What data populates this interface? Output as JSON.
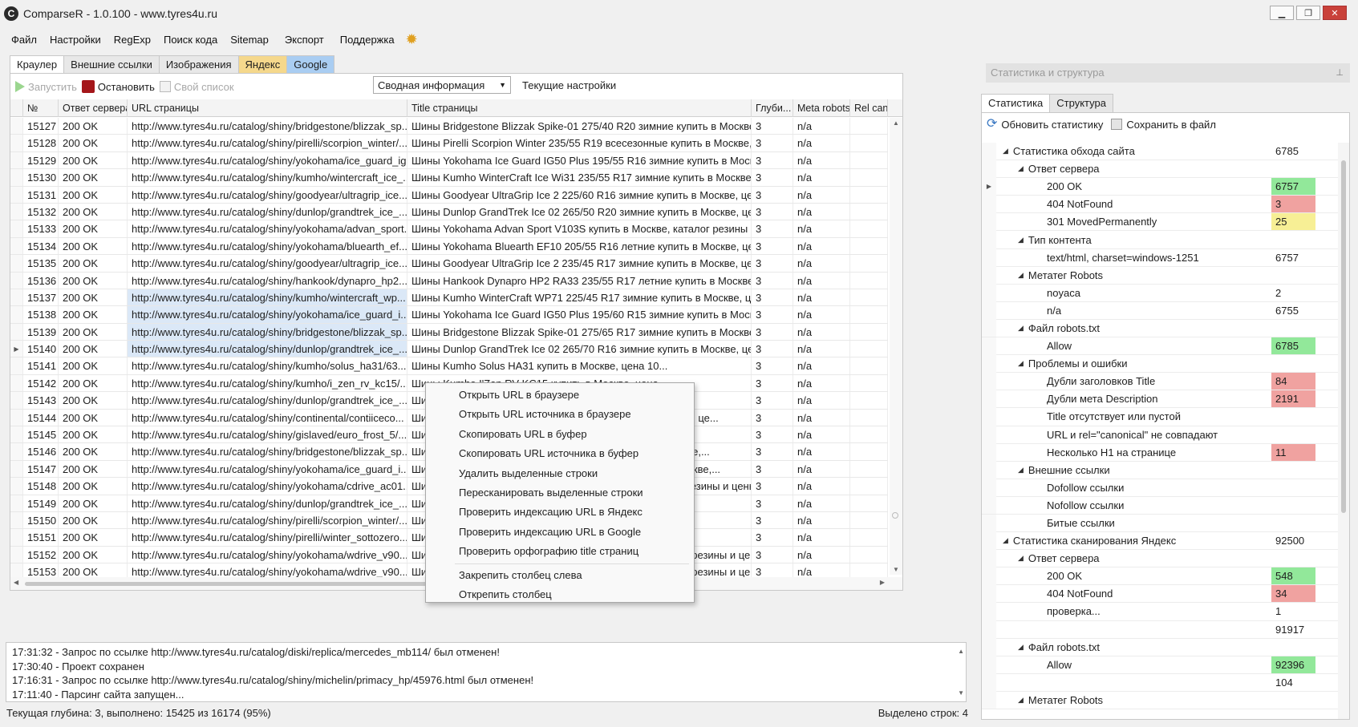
{
  "window": {
    "title": "ComparseR - 1.0.100 - www.tyres4u.ru",
    "logo_letter": "C",
    "minimize": "▁",
    "maximize": "❐",
    "close": "✕"
  },
  "menu": [
    "Файл",
    "Настройки",
    "RegExp",
    "Поиск кода",
    "Sitemap",
    "Экспорт",
    "Поддержка"
  ],
  "tabs": [
    "Краулер",
    "Внешние ссылки",
    "Изображения",
    "Яндекс",
    "Google"
  ],
  "toolbar": {
    "start": "Запустить",
    "stop": "Остановить",
    "own_list": "Свой список",
    "view_select": "Сводная информация",
    "current_settings": "Текущие настройки"
  },
  "grid": {
    "columns": [
      "№",
      "Ответ сервера",
      "URL страницы",
      "Title страницы",
      "Глуби...",
      "Meta robots",
      "Rel canc"
    ],
    "rows": [
      {
        "num": "15127",
        "resp": "200 OK",
        "url": "http://www.tyres4u.ru/catalog/shiny/bridgestone/blizzak_sp...",
        "title": "Шины Bridgestone Blizzak Spike-01 275/40 R20 зимние купить в Москве,...",
        "depth": "3",
        "meta": "n/a",
        "rel": ""
      },
      {
        "num": "15128",
        "resp": "200 OK",
        "url": "http://www.tyres4u.ru/catalog/shiny/pirelli/scorpion_winter/...",
        "title": "Шины Pirelli Scorpion Winter 235/55 R19 всесезонные купить в Москве,...",
        "depth": "3",
        "meta": "n/a",
        "rel": ""
      },
      {
        "num": "15129",
        "resp": "200 OK",
        "url": "http://www.tyres4u.ru/catalog/shiny/yokohama/ice_guard_ig...",
        "title": "Шины Yokohama Ice Guard IG50 Plus 195/55 R16 зимние купить в Москве,...",
        "depth": "3",
        "meta": "n/a",
        "rel": ""
      },
      {
        "num": "15130",
        "resp": "200 OK",
        "url": "http://www.tyres4u.ru/catalog/shiny/kumho/wintercraft_ice_...",
        "title": "Шины Kumho WinterCraft Ice Wi31 235/55 R17 зимние купить в Москве,...",
        "depth": "3",
        "meta": "n/a",
        "rel": ""
      },
      {
        "num": "15131",
        "resp": "200 OK",
        "url": "http://www.tyres4u.ru/catalog/shiny/goodyear/ultragrip_ice...",
        "title": "Шины Goodyear UltraGrip Ice 2 225/60 R16 зимние купить в Москве, це...",
        "depth": "3",
        "meta": "n/a",
        "rel": ""
      },
      {
        "num": "15132",
        "resp": "200 OK",
        "url": "http://www.tyres4u.ru/catalog/shiny/dunlop/grandtrek_ice_...",
        "title": "Шины Dunlop GrandTrek Ice 02 265/50 R20 зимние купить в Москве, це...",
        "depth": "3",
        "meta": "n/a",
        "rel": ""
      },
      {
        "num": "15133",
        "resp": "200 OK",
        "url": "http://www.tyres4u.ru/catalog/shiny/yokohama/advan_sport...",
        "title": "Шины Yokohama Advan Sport V103S купить в Москве, каталог резины и...",
        "depth": "3",
        "meta": "n/a",
        "rel": ""
      },
      {
        "num": "15134",
        "resp": "200 OK",
        "url": "http://www.tyres4u.ru/catalog/shiny/yokohama/bluearth_ef...",
        "title": "Шины Yokohama Bluearth EF10 205/55 R16 летние купить в Москве, цен...",
        "depth": "3",
        "meta": "n/a",
        "rel": ""
      },
      {
        "num": "15135",
        "resp": "200 OK",
        "url": "http://www.tyres4u.ru/catalog/shiny/goodyear/ultragrip_ice...",
        "title": "Шины Goodyear UltraGrip Ice 2 235/45 R17 зимние купить в Москве, це...",
        "depth": "3",
        "meta": "n/a",
        "rel": ""
      },
      {
        "num": "15136",
        "resp": "200 OK",
        "url": "http://www.tyres4u.ru/catalog/shiny/hankook/dynapro_hp2...",
        "title": "Шины Hankook Dynapro HP2 RA33 235/55 R17 летние купить в Москве,...",
        "depth": "3",
        "meta": "n/a",
        "rel": ""
      },
      {
        "num": "15137",
        "resp": "200 OK",
        "url": "http://www.tyres4u.ru/catalog/shiny/kumho/wintercraft_wp...",
        "title": "Шины Kumho WinterCraft WP71 225/45 R17 зимние купить в Москве, ц...",
        "depth": "3",
        "meta": "n/a",
        "rel": "",
        "selected": true
      },
      {
        "num": "15138",
        "resp": "200 OK",
        "url": "http://www.tyres4u.ru/catalog/shiny/yokohama/ice_guard_i...",
        "title": "Шины Yokohama Ice Guard IG50 Plus 195/60 R15 зимние купить в Москве,...",
        "depth": "3",
        "meta": "n/a",
        "rel": "",
        "selected": true
      },
      {
        "num": "15139",
        "resp": "200 OK",
        "url": "http://www.tyres4u.ru/catalog/shiny/bridgestone/blizzak_sp...",
        "title": "Шины Bridgestone Blizzak Spike-01 275/65 R17 зимние купить в Москве,...",
        "depth": "3",
        "meta": "n/a",
        "rel": "",
        "selected": true
      },
      {
        "num": "15140",
        "resp": "200 OK",
        "url": "http://www.tyres4u.ru/catalog/shiny/dunlop/grandtrek_ice_...",
        "title": "Шины Dunlop GrandTrek Ice 02 265/70 R16 зимние купить в Москве, це...",
        "depth": "3",
        "meta": "n/a",
        "rel": "",
        "selected": true,
        "current": true
      },
      {
        "num": "15141",
        "resp": "200 OK",
        "url": "http://www.tyres4u.ru/catalog/shiny/kumho/solus_ha31/63...",
        "title": "Шины Kumho Solus HA31 купить в Москве, цена 10...",
        "depth": "3",
        "meta": "n/a",
        "rel": ""
      },
      {
        "num": "15142",
        "resp": "200 OK",
        "url": "http://www.tyres4u.ru/catalog/shiny/kumho/i_zen_rv_kc15/...",
        "title": "Шины Kumho I'Zen RV KC15 купить в Москве, цена...",
        "depth": "3",
        "meta": "n/a",
        "rel": ""
      },
      {
        "num": "15143",
        "resp": "200 OK",
        "url": "http://www.tyres4u.ru/catalog/shiny/dunlop/grandtrek_ice_...",
        "title": "Шины Dunlop GrandTrek Ice 02 купить в Москве, це...",
        "depth": "3",
        "meta": "n/a",
        "rel": ""
      },
      {
        "num": "15144",
        "resp": "200 OK",
        "url": "http://www.tyres4u.ru/catalog/shiny/continental/contiiceco...",
        "title": "Шины Continental ContiIceContact зимние купить в Москве, це...",
        "depth": "3",
        "meta": "n/a",
        "rel": ""
      },
      {
        "num": "15145",
        "resp": "200 OK",
        "url": "http://www.tyres4u.ru/catalog/shiny/gislaved/euro_frost_5/...",
        "title": "Шины Gislaved Euro Frost 5 купить в Москве, цена 1...",
        "depth": "3",
        "meta": "n/a",
        "rel": ""
      },
      {
        "num": "15146",
        "resp": "200 OK",
        "url": "http://www.tyres4u.ru/catalog/shiny/bridgestone/blizzak_sp...",
        "title": "Шины Bridgestone Blizzak Spike-01 зимние купить в Москве,...",
        "depth": "3",
        "meta": "n/a",
        "rel": ""
      },
      {
        "num": "15147",
        "resp": "200 OK",
        "url": "http://www.tyres4u.ru/catalog/shiny/yokohama/ice_guard_i...",
        "title": "Шины Yokohama Ice Guard IG50 Plus зимние купить в Москве,...",
        "depth": "3",
        "meta": "n/a",
        "rel": ""
      },
      {
        "num": "15148",
        "resp": "200 OK",
        "url": "http://www.tyres4u.ru/catalog/shiny/yokohama/cdrive_ac01...",
        "title": "Шины Yokohama C.Drive AC01 купить в Москве, каталог резины и цены...",
        "depth": "3",
        "meta": "n/a",
        "rel": ""
      },
      {
        "num": "15149",
        "resp": "200 OK",
        "url": "http://www.tyres4u.ru/catalog/shiny/dunlop/grandtrek_ice_...",
        "title": "Шины Dunlop GrandTrek Ice 02 купить в Москве, це...",
        "depth": "3",
        "meta": "n/a",
        "rel": ""
      },
      {
        "num": "15150",
        "resp": "200 OK",
        "url": "http://www.tyres4u.ru/catalog/shiny/pirelli/scorpion_winter/...",
        "title": "Шины Pirelli Scorpion Winter купить в Москве, це...",
        "depth": "3",
        "meta": "n/a",
        "rel": ""
      },
      {
        "num": "15151",
        "resp": "200 OK",
        "url": "http://www.tyres4u.ru/catalog/shiny/pirelli/winter_sottozero...",
        "title": "Шины Pirelli Winter Sottozero купить в Москве, цена...",
        "depth": "3",
        "meta": "n/a",
        "rel": ""
      },
      {
        "num": "15152",
        "resp": "200 OK",
        "url": "http://www.tyres4u.ru/catalog/shiny/yokohama/wdrive_v90...",
        "title": "Шины Yokohama W.Drive V902A купить в Москве, каталог резины и цен...",
        "depth": "3",
        "meta": "n/a",
        "rel": ""
      },
      {
        "num": "15153",
        "resp": "200 OK",
        "url": "http://www.tyres4u.ru/catalog/shiny/yokohama/wdrive_v90...",
        "title": "Шины Yokohama W.Drive V902A купить в Москве, каталог резины и цен...",
        "depth": "3",
        "meta": "n/a",
        "rel": ""
      }
    ]
  },
  "context_menu": {
    "group1": [
      "Открыть URL в браузере",
      "Открыть URL источника в браузере",
      "Скопировать URL в буфер",
      "Скопировать URL источника в буфер",
      "Удалить выделенные строки",
      "Пересканировать выделенные строки",
      "Проверить индексацию URL в Яндекс",
      "Проверить индексацию URL в Google",
      "Проверить орфографию title страниц"
    ],
    "group2": [
      "Закрепить столбец слева",
      "Открепить столбец"
    ]
  },
  "log": [
    "17:31:32 - Запрос по ссылке http://www.tyres4u.ru/catalog/diski/replica/mercedes_mb114/ был отменен!",
    "17:30:40 - Проект сохранен",
    "17:16:31 - Запрос по ссылке http://www.tyres4u.ru/catalog/shiny/michelin/primacy_hp/45976.html был отменен!",
    "17:11:40 - Парсинг сайта запущен..."
  ],
  "status": {
    "left": "Текущая глубина: 3, выполнено: 15425 из 16174 (95%)",
    "right": "Выделено строк: 4"
  },
  "right_panel": {
    "header": "Статистика и структура",
    "tabs": [
      "Статистика",
      "Структура"
    ],
    "refresh": "Обновить статистику",
    "save": "Сохранить в файл",
    "tree": [
      {
        "level": 0,
        "label": "Статистика обхода сайта",
        "value": "6785",
        "expanded": true
      },
      {
        "level": 1,
        "label": "Ответ сервера",
        "value": "",
        "expanded": true
      },
      {
        "level": 2,
        "label": "200 OK",
        "value": "6757",
        "color": "green",
        "current": true
      },
      {
        "level": 2,
        "label": "404 NotFound",
        "value": "3",
        "color": "red"
      },
      {
        "level": 2,
        "label": "301 MovedPermanently",
        "value": "25",
        "color": "yellow"
      },
      {
        "level": 1,
        "label": "Тип контента",
        "value": "",
        "expanded": true
      },
      {
        "level": 2,
        "label": "text/html, charset=windows-1251",
        "value": "6757"
      },
      {
        "level": 1,
        "label": "Метатег Robots",
        "value": "",
        "expanded": true
      },
      {
        "level": 2,
        "label": "noyaca",
        "value": "2"
      },
      {
        "level": 2,
        "label": "n/a",
        "value": "6755"
      },
      {
        "level": 1,
        "label": "Файл robots.txt",
        "value": "",
        "expanded": true
      },
      {
        "level": 2,
        "label": "Allow",
        "value": "6785",
        "color": "green"
      },
      {
        "level": 1,
        "label": "Проблемы и ошибки",
        "value": "",
        "expanded": true
      },
      {
        "level": 2,
        "label": "Дубли заголовков Title",
        "value": "84",
        "color": "red"
      },
      {
        "level": 2,
        "label": "Дубли мета Description",
        "value": "2191",
        "color": "red"
      },
      {
        "level": 2,
        "label": "Title отсутствует или пустой",
        "value": ""
      },
      {
        "level": 2,
        "label": "URL и rel=\"canonical\" не совпадают",
        "value": ""
      },
      {
        "level": 2,
        "label": "Несколько H1 на странице",
        "value": "11",
        "color": "red"
      },
      {
        "level": 1,
        "label": "Внешние ссылки",
        "value": "",
        "expanded": true
      },
      {
        "level": 2,
        "label": "Dofollow ссылки",
        "value": ""
      },
      {
        "level": 2,
        "label": "Nofollow ссылки",
        "value": ""
      },
      {
        "level": 2,
        "label": "Битые ссылки",
        "value": ""
      },
      {
        "level": 0,
        "label": "Статистика сканирования Яндекс",
        "value": "92500",
        "expanded": true
      },
      {
        "level": 1,
        "label": "Ответ сервера",
        "value": "",
        "expanded": true
      },
      {
        "level": 2,
        "label": "200 OK",
        "value": "548",
        "color": "green"
      },
      {
        "level": 2,
        "label": "404 NotFound",
        "value": "34",
        "color": "red"
      },
      {
        "level": 2,
        "label": "проверка...",
        "value": "1"
      },
      {
        "level": 2,
        "label": "",
        "value": "91917"
      },
      {
        "level": 1,
        "label": "Файл robots.txt",
        "value": "",
        "expanded": true
      },
      {
        "level": 2,
        "label": "Allow",
        "value": "92396",
        "color": "green"
      },
      {
        "level": 2,
        "label": "",
        "value": "104"
      },
      {
        "level": 1,
        "label": "Метатег Robots",
        "value": "",
        "expanded": true
      }
    ]
  },
  "colors": {
    "green": "#92e89a",
    "red": "#f0a2a0",
    "yellow": "#f7ef95",
    "yandex_tab": "#f5d88c",
    "google_tab": "#a9cdf2",
    "stop": "#a4161a"
  },
  "icons": {
    "gear": "gear-icon",
    "play": "play-icon",
    "stop": "stop-icon",
    "refresh": "refresh-icon",
    "save": "save-icon",
    "pin": "pin-icon"
  }
}
